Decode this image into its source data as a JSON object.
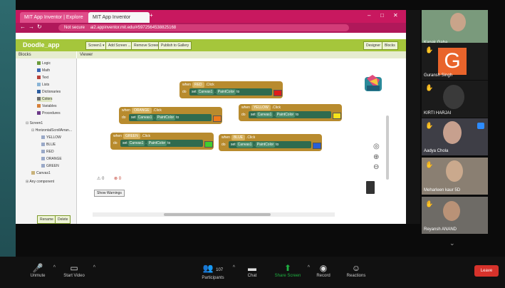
{
  "browser": {
    "tabs": [
      "MIT App Inventor | Explore MIT ...",
      "MIT App Inventor"
    ],
    "new_tab": "+",
    "address_warning": "Not secure",
    "url": "ai2.appinventor.mit.edu/#5972564538825168",
    "window_controls": [
      "–",
      "□",
      "✕"
    ]
  },
  "app_inventor": {
    "project_name": "Doodle_app",
    "toolbar_buttons": [
      "Screen1 ▾",
      "Add Screen ...",
      "Remove Screen",
      "Publish to Gallery"
    ],
    "mode_buttons": [
      "Designer",
      "Blocks"
    ],
    "blocks_header": "Blocks",
    "viewer_header": "Viewer",
    "builtin": [
      {
        "label": "Logic",
        "color": "#6b9b3c"
      },
      {
        "label": "Math",
        "color": "#3b67b4"
      },
      {
        "label": "Text",
        "color": "#b8403a"
      },
      {
        "label": "Lists",
        "color": "#8ab5d6"
      },
      {
        "label": "Dictionaries",
        "color": "#2d5da0"
      },
      {
        "label": "Colors",
        "color": "#6d6d6d"
      },
      {
        "label": "Variables",
        "color": "#d6813a"
      },
      {
        "label": "Procedures",
        "color": "#6c3a88"
      }
    ],
    "tree": [
      "Screen1",
      "HorizontalScrollArran...",
      "YELLOW",
      "BLUE",
      "RED",
      "ORANGE",
      "GREEN",
      "Canvas1",
      "Any component"
    ],
    "tree_buttons": [
      "Rename",
      "Delete"
    ],
    "event_blocks": [
      {
        "when": "when",
        "button": "RED",
        "event": ".Click",
        "do": "do",
        "set": "set",
        "component": "Canvas1",
        "property": "PaintColor",
        "to": "to",
        "swatch": "#e01b1b"
      },
      {
        "when": "when",
        "button": "ORANGE",
        "event": ".Click",
        "do": "do",
        "set": "set",
        "component": "Canvas1",
        "property": "PaintColor",
        "to": "to",
        "swatch": "#f07a1a"
      },
      {
        "when": "when",
        "button": "YELLOW",
        "event": ".Click",
        "do": "do",
        "set": "set",
        "component": "Canvas1",
        "property": "PaintColor",
        "to": "to",
        "swatch": "#f5e21a"
      },
      {
        "when": "when",
        "button": "GREEN",
        "event": ".Click",
        "do": "do",
        "set": "set",
        "component": "Canvas1",
        "property": "PaintColor",
        "to": "to",
        "swatch": "#3fcf2f"
      },
      {
        "when": "when",
        "button": "BLUE",
        "event": ".Click",
        "do": "do",
        "set": "set",
        "component": "Canvas1",
        "property": "PaintColor",
        "to": "to",
        "swatch": "#2a5fd6"
      }
    ],
    "warning_counts": [
      "0",
      "0"
    ],
    "show_warnings": "Show Warnings"
  },
  "participants": [
    {
      "name": "Kanak Gaba",
      "hand": false
    },
    {
      "name": "Guransh Singh",
      "hand": true,
      "avatar_letter": "G"
    },
    {
      "name": "KIRTI HARJAI",
      "hand": true
    },
    {
      "name": "Aadya Chola",
      "hand": true
    },
    {
      "name": "Meharleen kaur 5D",
      "hand": true
    },
    {
      "name": "Reyansh ANAND",
      "hand": true
    }
  ],
  "toolbar": {
    "unmute": "Unmute",
    "start_video": "Start Video",
    "participants": "Participants",
    "participant_count": "107",
    "chat": "Chat",
    "share_screen": "Share Screen",
    "record": "Record",
    "reactions": "Reactions",
    "leave": "Leave"
  },
  "colors": {
    "zoom_green": "#1fb141",
    "leave_red": "#d6322b",
    "browser_pink": "#c8185f",
    "ai_green": "#a5c63b"
  }
}
